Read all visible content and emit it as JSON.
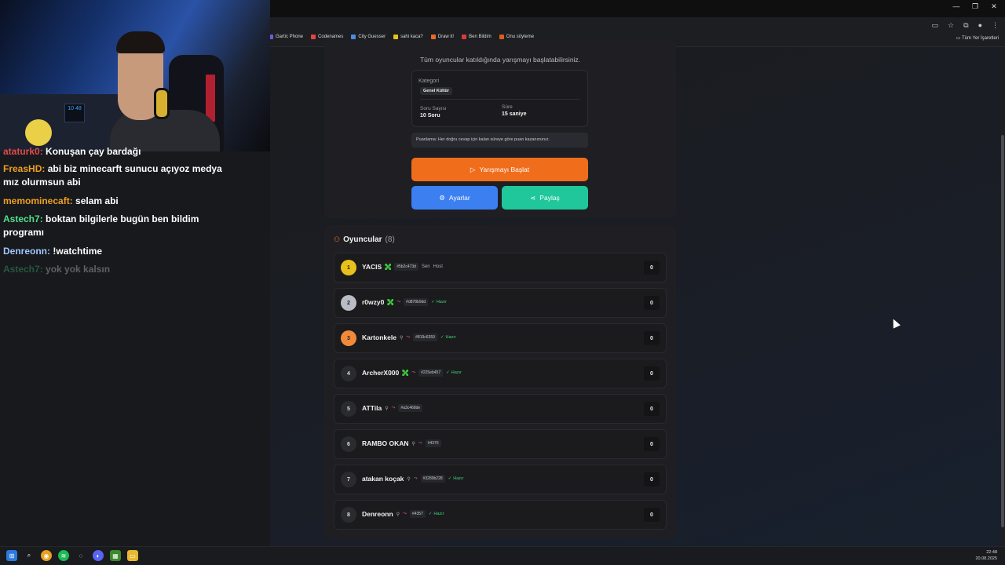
{
  "browser": {
    "bookmarks": [
      "Gartic Phone",
      "Codenames",
      "City Guesser",
      "sahi kaca?",
      "Draw it!",
      "Ben Bildim",
      "Onu söyleme"
    ],
    "bookmark_colors": [
      "#6d5cd6",
      "#e24444",
      "#4a8be0",
      "#e8c21a",
      "#e86a2a",
      "#d93a3a",
      "#e05a1a"
    ],
    "all_bookmarks": "Tüm Yer İşaretleri",
    "window_controls": [
      "—",
      "❐",
      "✕"
    ]
  },
  "lobby": {
    "subtitle": "Tüm oyuncular katıldığında yarışmayı başlatabilirsiniz.",
    "category_label": "Kategori",
    "category_value": "Genel Kültür",
    "question_count_label": "Soru Sayısı",
    "question_count_value": "10 Soru",
    "time_label": "Süre",
    "time_value": "15 saniye",
    "scoring_note": "Puanlama: Her doğru cevap için kalan süreye göre puan kazanırsınız.",
    "start_button": "Yarışmayı Başlat",
    "settings_button": "Ayarlar",
    "share_button": "Paylaş"
  },
  "players": {
    "title": "Oyuncular",
    "count": "(8)",
    "list": [
      {
        "rank": "1",
        "name": "YACIS",
        "tag": "#5b2c473d",
        "sen": "Sen",
        "host": "Host",
        "ready": "",
        "score": "0",
        "rank_color": "#e8c21a",
        "mc": true
      },
      {
        "rank": "2",
        "name": "r0wzy0",
        "tag": "#d878b9dd",
        "sen": "",
        "host": "",
        "ready": "Hazır",
        "score": "0",
        "rank_color": "#b9bcc4",
        "mc": true
      },
      {
        "rank": "3",
        "name": "Kartonkele",
        "tag": "#819c6359",
        "sen": "",
        "host": "",
        "ready": "Hazır",
        "score": "0",
        "rank_color": "#f08a3a",
        "mc": false
      },
      {
        "rank": "4",
        "name": "ArcherX000",
        "tag": "#225eb457",
        "sen": "",
        "host": "",
        "ready": "Hazır",
        "score": "0",
        "rank_color": "#2a2b2f",
        "mc": true
      },
      {
        "rank": "5",
        "name": "ATTila",
        "tag": "#a3c468de",
        "sen": "",
        "host": "",
        "ready": "",
        "score": "0",
        "rank_color": "#2a2b2f",
        "mc": false
      },
      {
        "rank": "6",
        "name": "RAMBO OKAN",
        "tag": "#4376",
        "sen": "",
        "host": "",
        "ready": "",
        "score": "0",
        "rank_color": "#2a2b2f",
        "mc": false
      },
      {
        "rank": "7",
        "name": "atakan koçak",
        "tag": "#3289b228",
        "sen": "",
        "host": "",
        "ready": "Hazır",
        "score": "0",
        "rank_color": "#2a2b2f",
        "mc": false
      },
      {
        "rank": "8",
        "name": "Denreonn",
        "tag": "#4357",
        "sen": "",
        "host": "",
        "ready": "Hazır",
        "score": "0",
        "rank_color": "#2a2b2f",
        "mc": false
      }
    ]
  },
  "webcam": {
    "monitor_text": "10 48"
  },
  "chat": [
    {
      "user": "ataturk0",
      "user_color": "#e04a4a",
      "text": "Konuşan çay bardağı",
      "opacity": 1
    },
    {
      "user": "FreasHD",
      "user_color": "#f0a020",
      "text": "abi biz minecarft sunucu açıyoz medya",
      "opacity": 1
    },
    {
      "user": "",
      "user_color": "#ffffff",
      "text": "mız olurmsun abi",
      "opacity": 1
    },
    {
      "user": "memominecaft",
      "user_color": "#f0a020",
      "text": "selam abi",
      "opacity": 1
    },
    {
      "user": "Astech7",
      "user_color": "#4fe08a",
      "text": "boktan bilgilerle bugün ben bildim",
      "opacity": 1
    },
    {
      "user": "",
      "user_color": "#ffffff",
      "text": "programı",
      "opacity": 1
    },
    {
      "user": "Denreonn",
      "user_color": "#a0c8ff",
      "text": "!watchtime",
      "opacity": 1
    },
    {
      "user": "Astech7",
      "user_color": "#4fe08a",
      "text": "yok yok kalsın",
      "opacity": 0.3
    }
  ],
  "taskbar": {
    "time": "22:48",
    "date": "20.08.2025"
  }
}
